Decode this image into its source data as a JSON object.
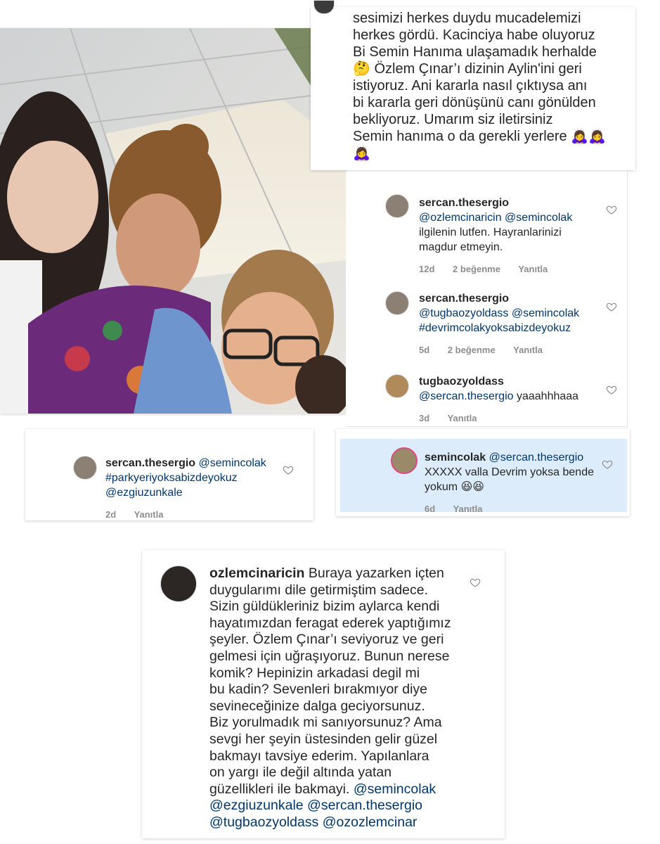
{
  "top_caption": {
    "lines": [
      "sesimizi herkes duydu mucadelemizi",
      "herkes gördü. Kacinciya habe oluyoruz",
      "Bi Semin Hanıma ulaşamadık herhalde",
      "🤔 Özlem Çınar’ı dizinin Aylin'ini geri",
      "istiyoruz. Ani kararla nasıl çıktıysa anı",
      "bi kararla geri dönüşünü canı gönülden",
      "bekliyoruz.  Umarım siz iletirsiniz",
      "Semin hanıma o da gerekli yerlere 🙇‍♀️🙇‍♀️",
      "🙇‍♀️"
    ]
  },
  "comments_right": [
    {
      "username": "sercan.thesergio",
      "mentions": "@ozlemcinaricin @semincolak",
      "text_lines": [
        "ilgilenin lutfen. Hayranlarinizi",
        "magdur etmeyin."
      ],
      "time": "12d",
      "likes": "2 beğenme",
      "reply": "Yanıtla"
    },
    {
      "username": "sercan.thesergio",
      "mentions": "@tugbaozyoldass @semincolak",
      "hashtag": "#devrimcolakyoksabizdeyokuz",
      "time": "5d",
      "likes": "2 beğenme",
      "reply": "Yanıtla"
    },
    {
      "username": "tugbaozyoldass",
      "mentions": "@sercan.thesergio",
      "text_after": " yaaahhhaaa",
      "time": "3d",
      "reply": "Yanıtla"
    }
  ],
  "comment_left": {
    "username": "sercan.thesergio",
    "mention1": "@semincolak",
    "hashtag": "#parkyeriyoksabizdeyokuz",
    "mention2": "@ezgiuzunkale",
    "time": "2d",
    "reply": "Yanıtla"
  },
  "comment_highlight": {
    "username": "semincolak",
    "mention": "@sercan.thesergio",
    "line2": "XXXXX valla Devrim yoksa bende",
    "line3": "yokum 😆😆",
    "time": "6d",
    "reply": "Yanıtla"
  },
  "comment_bottom": {
    "username": "ozlemcinaricin",
    "first_line_rest": " Buraya yazarken içten",
    "lines": [
      "duygularımı dile getirmiştim sadece.",
      "Sizin güldükleriniz bizim aylarca kendi",
      "hayatımızdan feragat ederek yaptığımız",
      "şeyler. Özlem Çınar’ı seviyoruz ve geri",
      "gelmesi için uğraşıyoruz.  Bunun nerese",
      "komik? Hepinizin arkadasi degil mi",
      "bu kadin? Sevenleri bırakmıyor diye",
      "sevineceğinize dalga geciyorsunuz.",
      "Biz yorulmadık mi sanıyorsunuz? Ama",
      "sevgi her şeyin üstesinden gelir güzel",
      "bakmayı tavsiye ederim. Yapılanlara",
      "on yargı ile değil altında yatan",
      "güzellikleri ile bakmayi."
    ],
    "tag_line1_a": "@semincolak",
    "tag_line2_a": "@ezgiuzunkale",
    "tag_line2_b": "@sercan.thesergio",
    "tag_line3_a": "@tugbaozyoldass",
    "tag_line3_b": "@ozozlemcinar"
  },
  "colors": {
    "mention": "#00376b",
    "meta": "#8e8e8e",
    "highlight_bg": "#dcecfa"
  },
  "icons": [
    "heart-icon",
    "avatar"
  ]
}
